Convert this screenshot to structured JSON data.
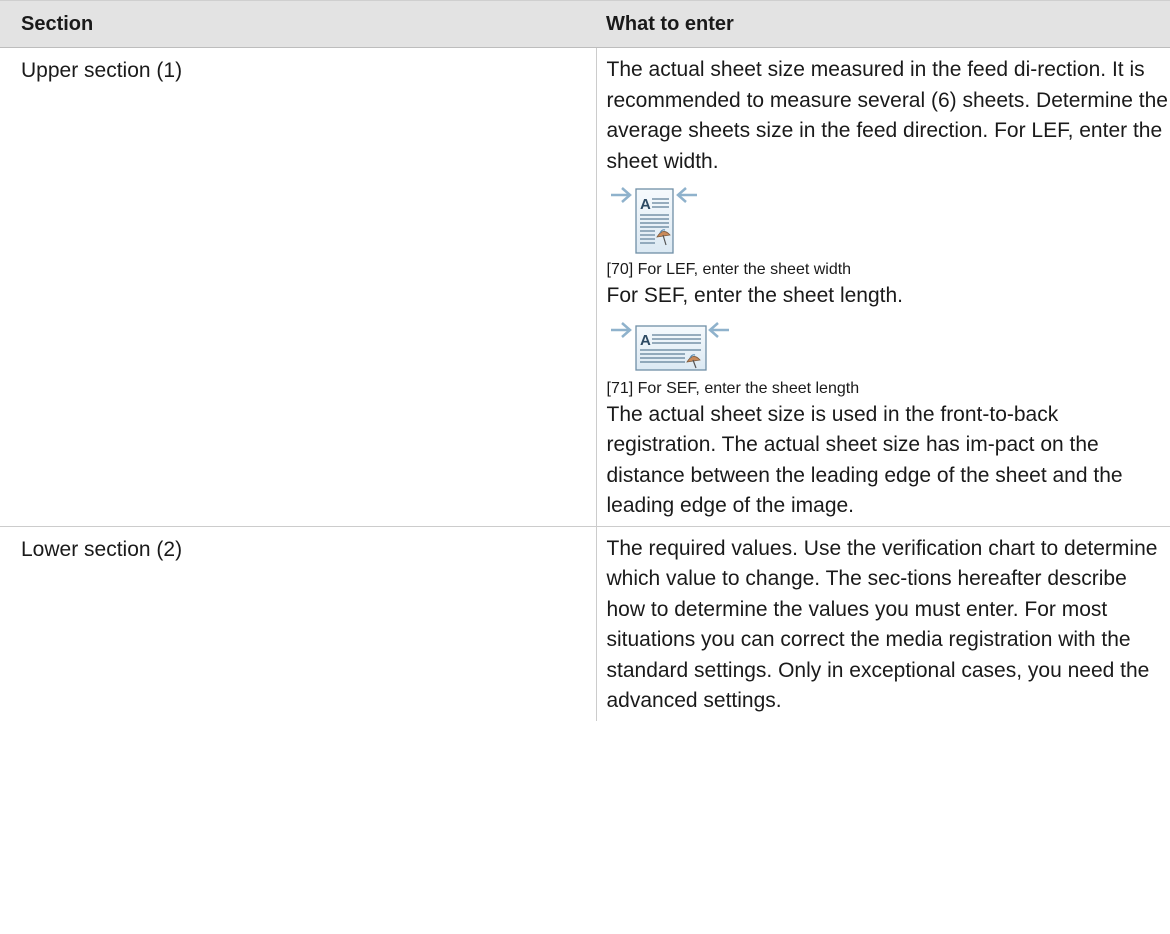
{
  "table": {
    "headers": [
      "Section",
      "What to enter"
    ],
    "rows": [
      {
        "section": "Upper section (1)",
        "intro": "The actual sheet size measured in the feed di-rection. It is recommended to measure several (6) sheets. Determine the average sheets size in the feed direction. For LEF, enter the sheet width.",
        "figure1": {
          "icon": "lef-sheet-width-icon",
          "letter": "A",
          "caption": "[70] For LEF, enter the sheet width"
        },
        "middle": "For SEF, enter the sheet length.",
        "figure2": {
          "icon": "sef-sheet-length-icon",
          "letter": "A",
          "caption": "[71] For SEF, enter the sheet length"
        },
        "outro": "The actual sheet size is used in the front-to-back registration. The actual sheet size has im-pact on the distance between the leading edge of the sheet and the leading edge of the image."
      },
      {
        "section": "Lower section (2)",
        "text": "The required values. Use the verification chart to determine which value to change. The sec-tions hereafter describe how to determine the values you must enter. For most situations you can correct the media registration with the standard settings. Only in exceptional cases, you need the advanced settings."
      }
    ]
  },
  "colors": {
    "header_bg": "#e3e3e3",
    "arrow": "#8fb2cc",
    "sheet_border": "#6f8ea6",
    "sheet_fill": "#e8f1f8"
  }
}
